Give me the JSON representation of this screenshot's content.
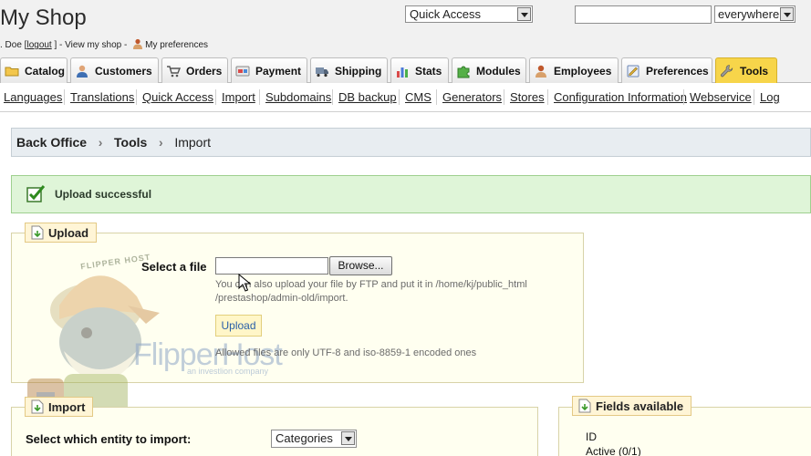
{
  "header": {
    "shop_name": "My Shop",
    "user_prefix": ". Doe [",
    "logout": "logout",
    "user_mid": "] - View my shop -",
    "preferences": "My preferences",
    "quick_access": "Quick Access",
    "search_value": "",
    "scope": "everywhere"
  },
  "tabs": [
    {
      "label": "Catalog",
      "icon": "folder-icon"
    },
    {
      "label": "Customers",
      "icon": "customers-icon"
    },
    {
      "label": "Orders",
      "icon": "cart-icon"
    },
    {
      "label": "Payment",
      "icon": "payment-icon"
    },
    {
      "label": "Shipping",
      "icon": "truck-icon"
    },
    {
      "label": "Stats",
      "icon": "bar-chart-icon"
    },
    {
      "label": "Modules",
      "icon": "puzzle-icon"
    },
    {
      "label": "Employees",
      "icon": "employee-icon"
    },
    {
      "label": "Preferences",
      "icon": "preferences-icon"
    },
    {
      "label": "Tools",
      "icon": "wrench-icon",
      "active": true
    }
  ],
  "submenu": [
    "Languages",
    "Translations",
    "Quick Access",
    "Import",
    "Subdomains",
    "DB backup",
    "CMS",
    "Generators",
    "Stores",
    "Configuration Information",
    "Webservice",
    "Log"
  ],
  "breadcrumb": [
    "Back Office",
    "Tools",
    "Import"
  ],
  "success_message": "Upload successful",
  "upload": {
    "legend": "Upload",
    "select_label": "Select a file",
    "browse_label": "Browse...",
    "hint_line1": "You can also upload your file by FTP and put it in /home/kj/public_html",
    "hint_line2": "/prestashop/admin-old/import.",
    "button": "Upload",
    "allowed_note": "Allowed files are only UTF-8 and iso-8859-1 encoded ones"
  },
  "import": {
    "legend": "Import",
    "entity_label": "Select which entity to import:",
    "entity_value": "Categories"
  },
  "fields": {
    "legend": "Fields available",
    "items": [
      "ID",
      "Active (0/1)"
    ]
  },
  "watermark": {
    "brand": "FlipperHost",
    "tagline": "an investlion company",
    "cap_text": "FLIPPER HOST"
  },
  "colors": {
    "active_tab": "#f7d54a",
    "success_bg": "#dff5d8",
    "panel_bg": "#fffff0",
    "link_blue": "#2a5fa8"
  }
}
